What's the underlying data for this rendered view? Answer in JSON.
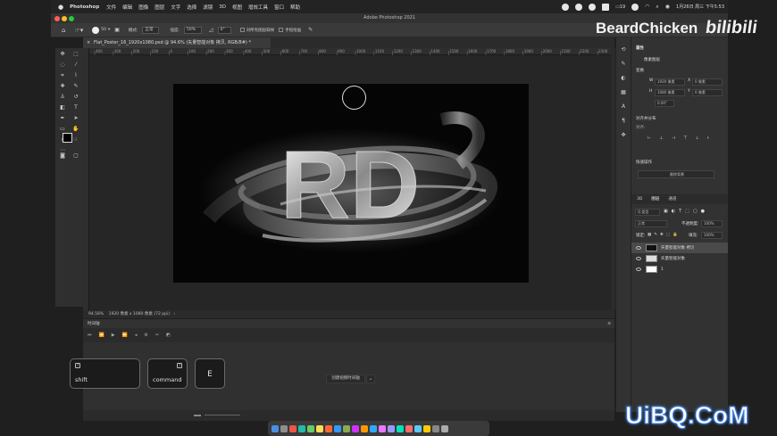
{
  "menubar": {
    "app": "Photoshop",
    "items": [
      "文件",
      "编辑",
      "图像",
      "图层",
      "文字",
      "选择",
      "滤镜",
      "3D",
      "视图",
      "增效工具",
      "窗口",
      "帮助"
    ],
    "battery": "19",
    "datetime": "1月26日 周三 下午5:53"
  },
  "window": {
    "title": "Adobe Photoshop 2021"
  },
  "options": {
    "brush_size": "50",
    "mode_label": "模式:",
    "mode_value": "正常",
    "opacity_label": "强度:",
    "opacity_value": "50%",
    "angle_value": "0°",
    "sample_all_label": "对所有图层取样",
    "finger_paint_label": "手指绘画"
  },
  "document": {
    "tab_title": "Flat_Poster_16_1920x1080.psd @ 94.6% (矢量智能对象 拷贝, RGB/8#) *",
    "zoom": "94.58%",
    "info": "1920 像素 x 1080 像素 (72 ppi)"
  },
  "ruler_labels": [
    "400",
    "300",
    "200",
    "100",
    "0",
    "100",
    "200",
    "300",
    "400",
    "500",
    "600",
    "700",
    "800",
    "900",
    "1000",
    "1100",
    "1200",
    "1300",
    "1400",
    "1500",
    "1600",
    "1700",
    "1800",
    "1900",
    "2000",
    "2100",
    "2200",
    "2300"
  ],
  "artwork": {
    "text": "RD"
  },
  "timeline": {
    "title": "时间轴",
    "create_button": "创建视频时间轴"
  },
  "keys": [
    {
      "symbol": "?",
      "label": "shift"
    },
    {
      "symbol": "?",
      "label": "command"
    },
    {
      "symbol": "",
      "label": "E"
    }
  ],
  "properties": {
    "title": "属性",
    "type_label": "像素图层",
    "transform_label": "变换",
    "w_label": "W",
    "w_value": "1920 像素",
    "h_label": "H",
    "h_value": "1080 像素",
    "x_label": "X",
    "x_value": "0 像素",
    "y_label": "Y",
    "y_value": "0 像素",
    "angle_value": "0.00°",
    "align_title": "对齐并分布",
    "align_label": "对齐:",
    "quick_actions_title": "快速操作",
    "remove_bg_button": "删除背景"
  },
  "layers_panel": {
    "tabs": [
      "3D",
      "图层",
      "通道"
    ],
    "filter_label": "Q 类型",
    "blend_mode": "正常",
    "opacity_label": "不透明度:",
    "opacity_value": "100%",
    "lock_label": "锁定:",
    "fill_label": "填充:",
    "fill_value": "100%",
    "layers": [
      {
        "name": "矢量智能对象 拷贝"
      },
      {
        "name": "矢量智能对象"
      },
      {
        "name": "1"
      }
    ]
  },
  "watermarks": {
    "channel": "BeardChicken",
    "platform": "bilibili",
    "site": "UiBQ.CoM"
  },
  "colors": {
    "menubar_bg": "#232323",
    "panel_bg": "#323232",
    "canvas_bg": "#262626",
    "art_bg": "#050505",
    "accent_blue": "#3a7be0"
  }
}
